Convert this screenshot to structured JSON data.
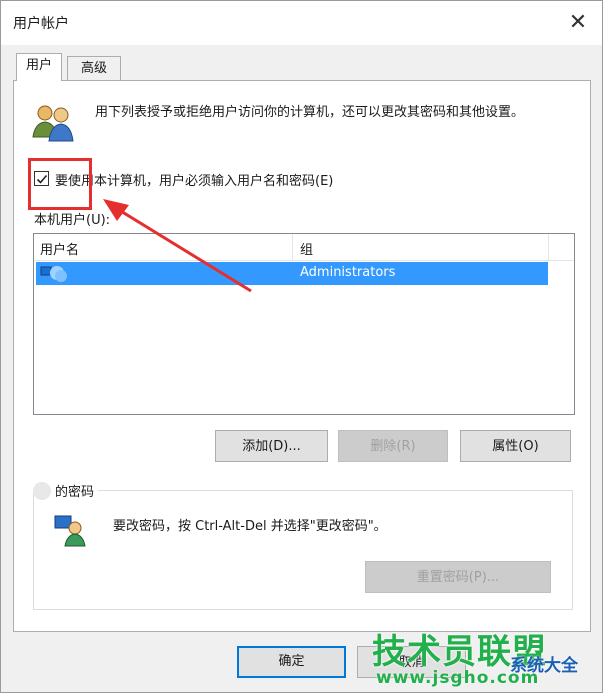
{
  "window": {
    "title": "用户帐户",
    "close_glyph": "✕"
  },
  "tabs": [
    {
      "label": "用户",
      "active": true
    },
    {
      "label": "高级",
      "active": false
    }
  ],
  "description": "用下列表授予或拒绝用户访问你的计算机，还可以更改其密码和其他设置。",
  "checkbox": {
    "label": "要使用本计算机，用户必须输入用户名和密码(E)",
    "checked": true
  },
  "local_users": {
    "label": "本机用户(U):",
    "columns": [
      "用户名",
      "组"
    ],
    "rows": [
      {
        "name": "",
        "group": "Administrators",
        "selected": true
      }
    ]
  },
  "buttons": {
    "add": "添加(D)...",
    "remove": "删除(R)",
    "properties": "属性(O)",
    "reset_password": "重置密码(P)...",
    "ok": "确定",
    "cancel": "取消"
  },
  "password_group": {
    "title": "的密码",
    "text": "要改密码，按 Ctrl-Alt-Del 并选择\"更改密码\"。"
  },
  "watermark": {
    "main": "技术员联盟",
    "sub": "系统大全",
    "url": "www.jsgho.com"
  },
  "colors": {
    "selection": "#3399ff",
    "annotation_red": "#e52e2e",
    "default_button_border": "#0078d7",
    "watermark_green": "#21b04b",
    "watermark_blue": "#1a5fb4"
  },
  "icons": {
    "users": "users-icon",
    "user_row": "user-icon",
    "password": "password-user-icon",
    "check": "checkmark-icon",
    "arrow": "annotation-arrow"
  }
}
